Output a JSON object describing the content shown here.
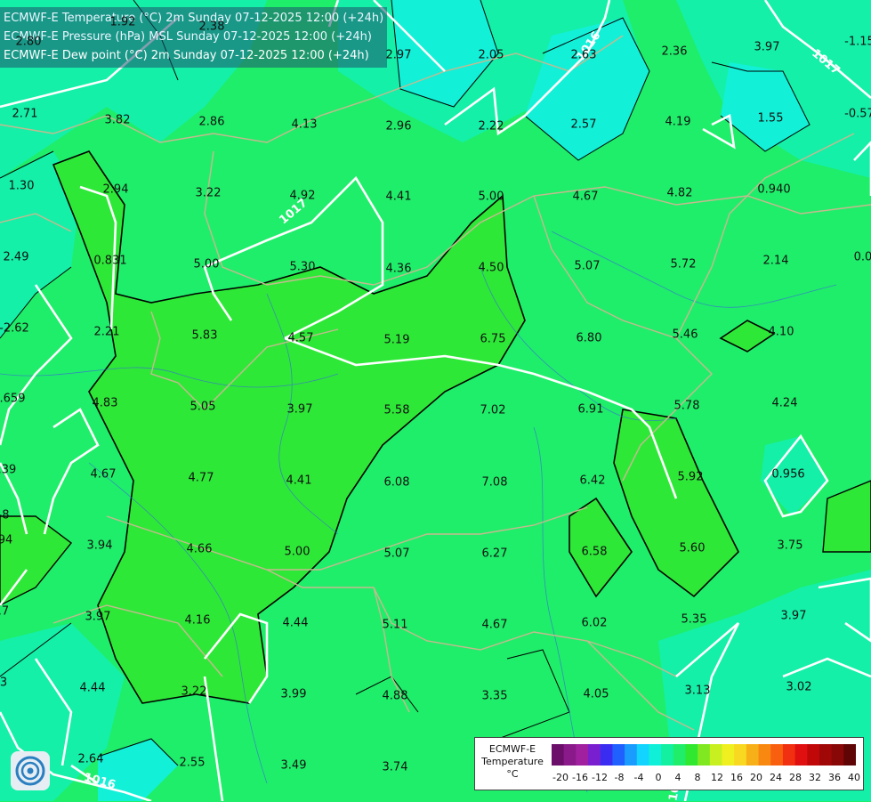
{
  "header": {
    "lines": [
      "ECMWF-E Temperature (°C) 2m Sunday 07-12-2025 12:00 (+24h)",
      "ECMWF-E Pressure (hPa) MSL Sunday 07-12-2025 12:00 (+24h)",
      "ECMWF-E Dew point (°C) 2m Sunday 07-12-2025 12:00 (+24h)"
    ]
  },
  "isobar_labels": [
    "1016",
    "1017",
    "1017",
    "1016",
    "1017"
  ],
  "values": [
    "2.80",
    "1.92",
    "2.38",
    "2.97",
    "2.05",
    "2.63",
    "2.36",
    "3.97",
    "-1.15",
    "2.71",
    "3.82",
    "2.86",
    "4.13",
    "2.96",
    "2.22",
    "2.57",
    "4.19",
    "1.55",
    "-0.57",
    "1.30",
    "2.94",
    "3.22",
    "4.92",
    "4.41",
    "5.00",
    "4.67",
    "4.82",
    "0.940",
    "2.49",
    "0.831",
    "5.00",
    "5.30",
    "4.36",
    "4.50",
    "5.07",
    "5.72",
    "2.14",
    "0.0",
    "-2.62",
    "2.21",
    "5.83",
    "4.57",
    "5.19",
    "6.75",
    "6.80",
    "5.46",
    "4.10",
    ".659",
    "4.83",
    "5.05",
    "3.97",
    "5.58",
    "7.02",
    "6.91",
    "5.78",
    "4.24",
    ".39",
    "4.67",
    "4.77",
    "4.41",
    "6.08",
    "7.08",
    "6.42",
    "5.92",
    "0.956",
    "-8",
    "94",
    "3.94",
    "4.66",
    "5.00",
    "5.07",
    "6.27",
    "6.58",
    "5.60",
    "3.75",
    ".7",
    "3.97",
    "4.16",
    "4.44",
    "5.11",
    "4.67",
    "6.02",
    "5.35",
    "3.97",
    "3",
    "4.44",
    "3.22",
    "3.99",
    "4.88",
    "3.35",
    "4.05",
    "3.13",
    "3.02",
    "2.64",
    "2.55",
    "3.49",
    "3.74"
  ],
  "legend": {
    "title_lines": [
      "ECMWF-E",
      "Temperature",
      "°C"
    ],
    "ticks": [
      "-20",
      "-16",
      "-12",
      "-8",
      "-4",
      "0",
      "4",
      "8",
      "12",
      "16",
      "20",
      "24",
      "28",
      "32",
      "36",
      "40"
    ],
    "colors": [
      "#6b0f6b",
      "#8a1a8a",
      "#a020a0",
      "#7a1fd0",
      "#3a2cf0",
      "#2060ff",
      "#1a9cff",
      "#12d4ff",
      "#10f0d8",
      "#12f0a0",
      "#20ee6a",
      "#30e830",
      "#80e820",
      "#c8f020",
      "#f0f020",
      "#f8d820",
      "#f8b018",
      "#f88810",
      "#f86010",
      "#f03010",
      "#e01010",
      "#c00808",
      "#a00808",
      "#880808",
      "#600505"
    ]
  },
  "colors": {
    "field_main": "#1fee6a",
    "field_warm": "#2ee838",
    "field_cool": "#14f0a8",
    "field_cold": "#12f0d8",
    "isobar": "#ffffff",
    "border": "#c8b890"
  },
  "icons": [
    "ecmwf-logo-icon"
  ]
}
